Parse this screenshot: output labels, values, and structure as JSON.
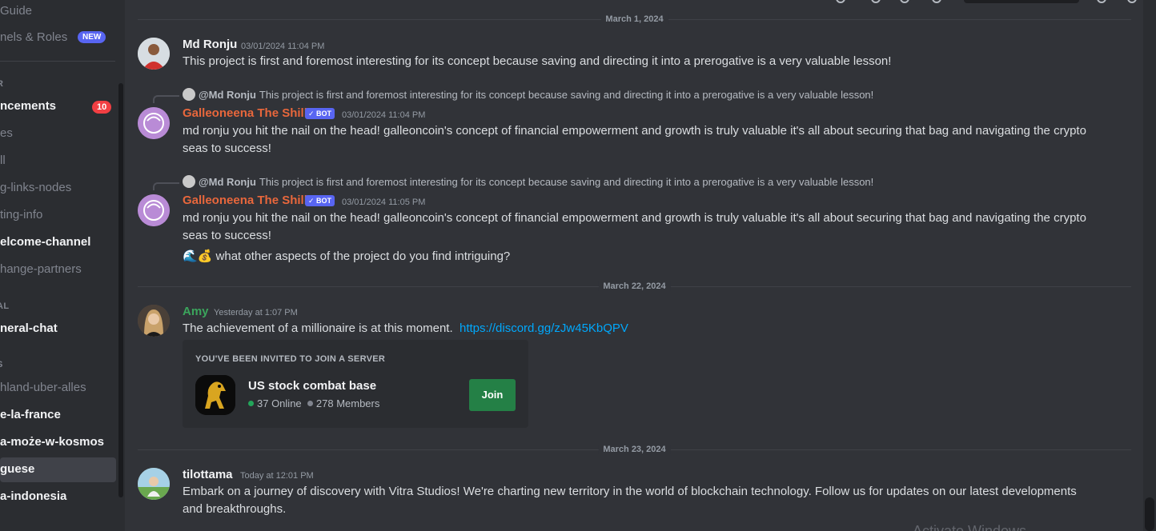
{
  "sidebar": {
    "channels": [
      {
        "label": "Guide",
        "style": "muted"
      },
      {
        "label": "nels & Roles",
        "style": "muted",
        "badge": "NEW"
      },
      {
        "label": "ncements",
        "style": "bright",
        "badge": "10"
      },
      {
        "label": "es",
        "style": "muted"
      },
      {
        "label": "ll",
        "style": "muted"
      },
      {
        "label": "g-links-nodes",
        "style": "muted"
      },
      {
        "label": "ting-info",
        "style": "muted"
      },
      {
        "label": "elcome-channel",
        "style": "bright"
      },
      {
        "label": "hange-partners",
        "style": "muted"
      },
      {
        "label": "neral-chat",
        "style": "bright"
      },
      {
        "label": "hland-uber-alles",
        "style": "muted"
      },
      {
        "label": "e-la-france",
        "style": "bright"
      },
      {
        "label": "a-może-w-kosmos",
        "style": "bright"
      },
      {
        "label": "guese",
        "style": "bright",
        "selected": true
      },
      {
        "label": "a-indonesia",
        "style": "bright"
      }
    ],
    "categories": [
      "R",
      "AL",
      "S"
    ],
    "new_badge": "NEW",
    "count_badge": "10"
  },
  "date_dividers": [
    "March 1, 2024",
    "March 22, 2024",
    "March 23, 2024"
  ],
  "messages": [
    {
      "author": "Md Ronju",
      "timestamp": "03/01/2024 11:04 PM",
      "text": "This project is first and foremost interesting for its concept because saving and directing it into a prerogative is a very valuable lesson!"
    },
    {
      "reply_to": "@Md Ronju",
      "reply_text": "This project is first and foremost interesting for its concept because saving and directing it into a prerogative is a very valuable lesson!",
      "author": "Galleoneena The Shill",
      "bot_label": "BOT",
      "timestamp": "03/01/2024 11:04 PM",
      "text": "md ronju you hit the nail on the head! galleoncoin's concept of financial empowerment and growth is truly valuable it's all about securing that bag and navigating the crypto seas to success!"
    },
    {
      "reply_to": "@Md Ronju",
      "reply_text": "This project is first and foremost interesting for its concept because saving and directing it into a prerogative is a very valuable lesson!",
      "author": "Galleoneena The Shill",
      "bot_label": "BOT",
      "timestamp": "03/01/2024 11:05 PM",
      "text": "md ronju you hit the nail on the head! galleoncoin's concept of financial empowerment and growth is truly valuable it's all about securing that bag and navigating the crypto seas to success!",
      "followup_emoji": "🌊💰",
      "followup": "what other aspects of the project do you find intriguing?"
    },
    {
      "author": "Amy",
      "timestamp": "Yesterday at 1:07 PM",
      "text": "The achievement of a millionaire is at this moment.",
      "link": "https://discord.gg/zJw45KbQPV"
    },
    {
      "author": "tilottama",
      "timestamp": "Today at 12:01 PM",
      "text": "Embark on a journey of discovery with Vitra Studios! We're charting new territory in the world of blockchain technology. Follow us for updates on our latest developments and breakthroughs."
    }
  ],
  "invite": {
    "heading": "YOU'VE BEEN INVITED TO JOIN A SERVER",
    "server_name": "US stock combat base",
    "online": "37 Online",
    "members": "278 Members",
    "join_label": "Join"
  },
  "colors": {
    "bot_name": "#e8673c",
    "amy_name": "#3ba55c",
    "online_dot": "#23a55a",
    "link": "#00a8fc"
  },
  "watermark": "Activate Windows"
}
